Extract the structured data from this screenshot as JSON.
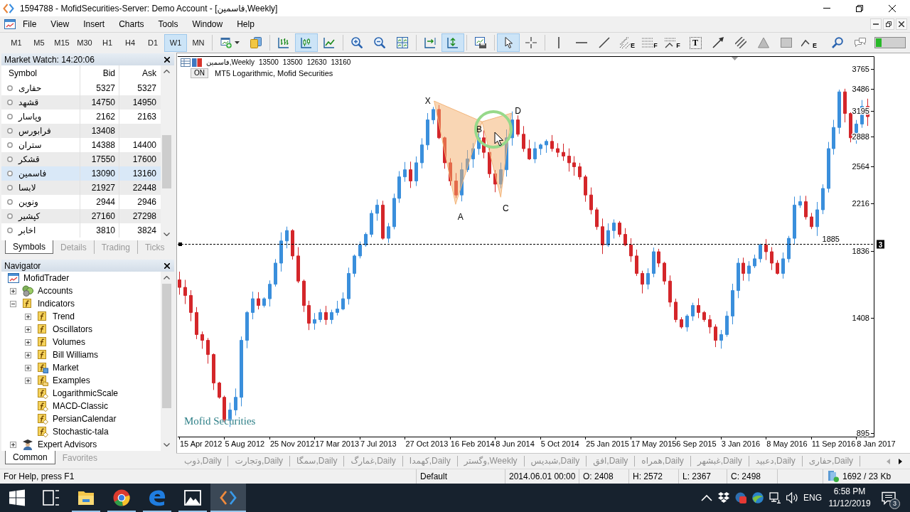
{
  "window": {
    "title": "1594788 - MofidSecurities-Server: Demo Account - [فاسمین,Weekly]"
  },
  "menu": {
    "items": [
      "File",
      "View",
      "Insert",
      "Charts",
      "Tools",
      "Window",
      "Help"
    ]
  },
  "toolbar": {
    "timeframes": [
      {
        "label": "M1",
        "selected": false
      },
      {
        "label": "M5",
        "selected": false
      },
      {
        "label": "M15",
        "selected": false
      },
      {
        "label": "M30",
        "selected": false
      },
      {
        "label": "H1",
        "selected": false
      },
      {
        "label": "H4",
        "selected": false
      },
      {
        "label": "D1",
        "selected": false
      },
      {
        "label": "W1",
        "selected": true
      },
      {
        "label": "MN",
        "selected": false
      }
    ],
    "groups": [
      {
        "tools": [
          {
            "kind": "new-chart",
            "selected": false
          },
          {
            "kind": "algo-trading",
            "selected": false
          }
        ]
      },
      {
        "tools": [
          {
            "kind": "bar-chart",
            "selected": false
          },
          {
            "kind": "candlesticks",
            "selected": true
          },
          {
            "kind": "line-chart",
            "selected": false
          }
        ]
      },
      {
        "tools": [
          {
            "kind": "zoom-in",
            "selected": false
          },
          {
            "kind": "zoom-out",
            "selected": false
          },
          {
            "kind": "tile",
            "selected": false
          }
        ]
      },
      {
        "tools": [
          {
            "kind": "chart-shift",
            "selected": false
          },
          {
            "kind": "auto-scroll",
            "selected": true
          }
        ]
      },
      {
        "tools": [
          {
            "kind": "templates",
            "selected": false
          }
        ]
      },
      {
        "tools": [
          {
            "kind": "cursor",
            "selected": true
          },
          {
            "kind": "crosshair",
            "selected": false
          }
        ]
      },
      {
        "tools": [
          {
            "kind": "vertical-line",
            "selected": false
          },
          {
            "kind": "horizontal-line",
            "selected": false
          },
          {
            "kind": "trend-line",
            "selected": false
          },
          {
            "kind": "stairs",
            "badge": "E",
            "selected": false
          },
          {
            "kind": "dotted-lines",
            "badge": "F",
            "selected": false
          },
          {
            "kind": "dotted-fan",
            "badge": "F",
            "selected": false
          },
          {
            "kind": "text",
            "badge": "T",
            "selected": false
          },
          {
            "kind": "arrow",
            "selected": false
          },
          {
            "kind": "channel",
            "selected": false
          },
          {
            "kind": "triangle",
            "selected": false
          },
          {
            "kind": "rectangle",
            "selected": false
          },
          {
            "kind": "zigzag",
            "badge": "E",
            "selected": false
          }
        ]
      }
    ],
    "extras": [
      {
        "kind": "search",
        "selected": false
      },
      {
        "kind": "chat",
        "selected": false
      }
    ]
  },
  "market_watch": {
    "title": "Market Watch: 14:20:06",
    "columns": [
      "Symbol",
      "Bid",
      "Ask"
    ],
    "rows": [
      {
        "symbol": "حفاری",
        "bid": "5327",
        "ask": "5327",
        "selected": false
      },
      {
        "symbol": "قشهد",
        "bid": "14750",
        "ask": "14950",
        "selected": false
      },
      {
        "symbol": "وپاسار",
        "bid": "2162",
        "ask": "2163",
        "selected": false
      },
      {
        "symbol": "فرابورس",
        "bid": "13408",
        "selected": false
      },
      {
        "symbol": "ستران",
        "bid": "14388",
        "ask": "14400",
        "selected": false
      },
      {
        "symbol": "قشکر",
        "bid": "17550",
        "ask": "17600",
        "selected": false
      },
      {
        "symbol": "فاسمین",
        "bid": "13090",
        "ask": "13160",
        "selected": true
      },
      {
        "symbol": "لابسا",
        "bid": "21927",
        "ask": "22448",
        "selected": false
      },
      {
        "symbol": "ونوین",
        "bid": "2944",
        "ask": "2946",
        "selected": false
      },
      {
        "symbol": "کپشیر",
        "bid": "27160",
        "ask": "27298",
        "selected": false
      },
      {
        "symbol": "اخابر",
        "bid": "3810",
        "ask": "3824",
        "selected": false
      }
    ],
    "tabs": [
      {
        "label": "Symbols",
        "selected": true
      },
      {
        "label": "Details",
        "selected": false
      },
      {
        "label": "Trading",
        "selected": false
      },
      {
        "label": "Ticks",
        "selected": false
      }
    ]
  },
  "navigator": {
    "title": "Navigator",
    "tree": [
      {
        "label": "MofidTrader",
        "kind": "root",
        "children": [
          {
            "label": "Accounts",
            "kind": "accounts",
            "expanded": false
          },
          {
            "label": "Indicators",
            "kind": "folder",
            "expanded": true,
            "children": [
              {
                "label": "Trend",
                "kind": "folder",
                "expanded": false
              },
              {
                "label": "Oscillators",
                "kind": "folder",
                "expanded": false
              },
              {
                "label": "Volumes",
                "kind": "folder",
                "expanded": false
              },
              {
                "label": "Bill Williams",
                "kind": "folder",
                "expanded": false
              },
              {
                "label": "Market",
                "kind": "market",
                "expanded": false
              },
              {
                "label": "Examples",
                "kind": "examples",
                "expanded": false
              },
              {
                "label": "LogarithmicScale",
                "kind": "indicator"
              },
              {
                "label": "MACD-Classic",
                "kind": "indicator"
              },
              {
                "label": "PersianCalendar",
                "kind": "indicator"
              },
              {
                "label": "Stochastic-tala",
                "kind": "indicator"
              }
            ]
          },
          {
            "label": "Expert Advisors",
            "kind": "experts",
            "expanded": false
          }
        ]
      }
    ],
    "tabs": [
      {
        "label": "Common",
        "selected": true
      },
      {
        "label": "Favorites",
        "selected": false
      }
    ]
  },
  "chart": {
    "symbol": "فاسمین,Weekly",
    "prices": [
      "13500",
      "13500",
      "12630",
      "13160"
    ],
    "indicator_button": "ON",
    "indicator": "MT5 Logarithmic, Mofid Securities",
    "watermark": "Mofid Securities",
    "price_axis": [
      "3765",
      "3486",
      "3195",
      "2888",
      "2564",
      "2216",
      "1836",
      "1408",
      "895"
    ],
    "date_axis": [
      "15 Apr 2012",
      "5 Aug 2012",
      "25 Nov 2012",
      "17 Mar 2013",
      "7 Jul 2013",
      "27 Oct 2013",
      "16 Feb 2014",
      "8 Jun 2014",
      "5 Oct 2014",
      "25 Jan 2015",
      "17 May 2015",
      "6 Sep 2015",
      "3 Jan 2016",
      "8 May 2016",
      "11 Sep 2016",
      "8 Jan 2017"
    ],
    "pattern_labels": [
      "X",
      "A",
      "B",
      "C",
      "D"
    ],
    "line_label": "1885",
    "line_marker": "3"
  },
  "chart_tabs": [
    {
      "label": "ذوب,Daily",
      "selected": false
    },
    {
      "label": "وتجارت,Daily",
      "selected": false
    },
    {
      "label": "سمگا,Daily",
      "selected": false
    },
    {
      "label": "غمارگ,Daily",
      "selected": false
    },
    {
      "label": "کهمدا,Daily",
      "selected": false
    },
    {
      "label": "وگستر,Weekly",
      "selected": false
    },
    {
      "label": "شبدیس,Daily",
      "selected": false
    },
    {
      "label": "افق,Daily",
      "selected": false
    },
    {
      "label": "همراه,Daily",
      "selected": false
    },
    {
      "label": "غبشهر,Daily",
      "selected": false
    },
    {
      "label": "دعبید,Daily",
      "selected": false
    },
    {
      "label": "حفاری,Daily",
      "selected": false
    }
  ],
  "status_bar": {
    "help": "For Help, press F1",
    "profile": "Default",
    "time": "2014.06.01 00:00",
    "open": "O: 2408",
    "high": "H: 2572",
    "low": "L: 2367",
    "close": "C: 2498",
    "traffic": "1692 / 23 Kb"
  },
  "taskbar": {
    "buttons": [
      {
        "kind": "start",
        "running": false,
        "selected": false
      },
      {
        "kind": "task-view",
        "running": false,
        "selected": false
      },
      {
        "kind": "folder",
        "running": true,
        "selected": false
      },
      {
        "kind": "circle-logo",
        "running": true,
        "selected": false
      },
      {
        "kind": "swirl",
        "running": true,
        "selected": false
      },
      {
        "kind": "picture",
        "running": true,
        "selected": false
      },
      {
        "kind": "code-arrows",
        "running": true,
        "selected": true
      }
    ],
    "tray": [
      {
        "kind": "chevron"
      },
      {
        "kind": "diamonds"
      },
      {
        "kind": "app-badge"
      },
      {
        "kind": "globe"
      },
      {
        "kind": "network"
      },
      {
        "kind": "speaker"
      }
    ],
    "language": "ENG",
    "time": "6:58 PM",
    "date": "11/12/2019",
    "notifications": "3"
  }
}
